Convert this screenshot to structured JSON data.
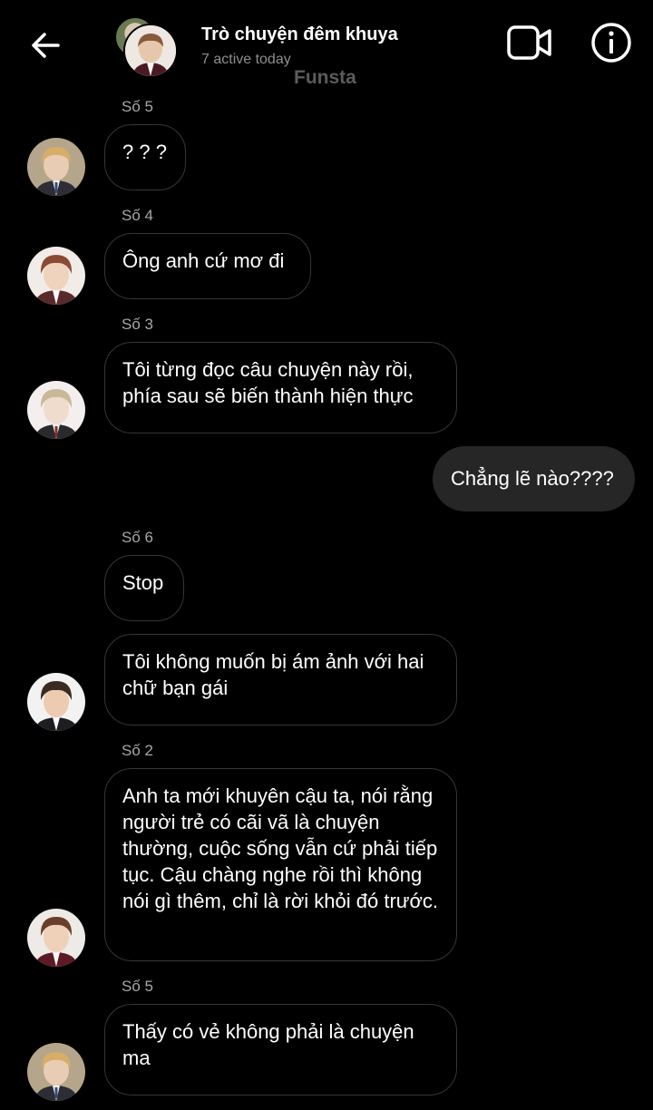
{
  "header": {
    "title": "Trò chuyện đêm khuya",
    "subtitle": "7 active today",
    "watermark": "Funsta"
  },
  "messages": [
    {
      "sender": "Số 5",
      "text": "? ? ?",
      "avatar": "avatar-blond-boy"
    },
    {
      "sender": "Số 4",
      "text": "Ông anh cứ mơ đi",
      "avatar": "avatar-red-hair-boy"
    },
    {
      "sender": "Số 3",
      "text": "Tôi từng đọc câu chuyện này rồi, phía sau sẽ biến thành hiện thực",
      "avatar": "avatar-light-hair-boy"
    },
    {
      "sender": "",
      "text": "Chẳng lẽ nào????",
      "outgoing": true
    },
    {
      "sender": "Số 6",
      "text": "Stop"
    },
    {
      "sender": "",
      "text": "Tôi không muốn bị ám ảnh với hai chữ bạn gái",
      "avatar": "avatar-dark-hair-boy"
    },
    {
      "sender": "Số 2",
      "text": "Anh ta mới khuyên cậu ta, nói rằng người trẻ có cãi vã là chuyện thường, cuộc sống vẫn cứ phải tiếp tục. Cậu chàng nghe rồi thì không nói gì thêm, chỉ là rời khỏi đó trước.",
      "avatar": "avatar-brown-hair-boy"
    },
    {
      "sender": "Số 5",
      "text": "Thấy có vẻ không phải là chuyện ma",
      "avatar": "avatar-blond-boy"
    }
  ]
}
